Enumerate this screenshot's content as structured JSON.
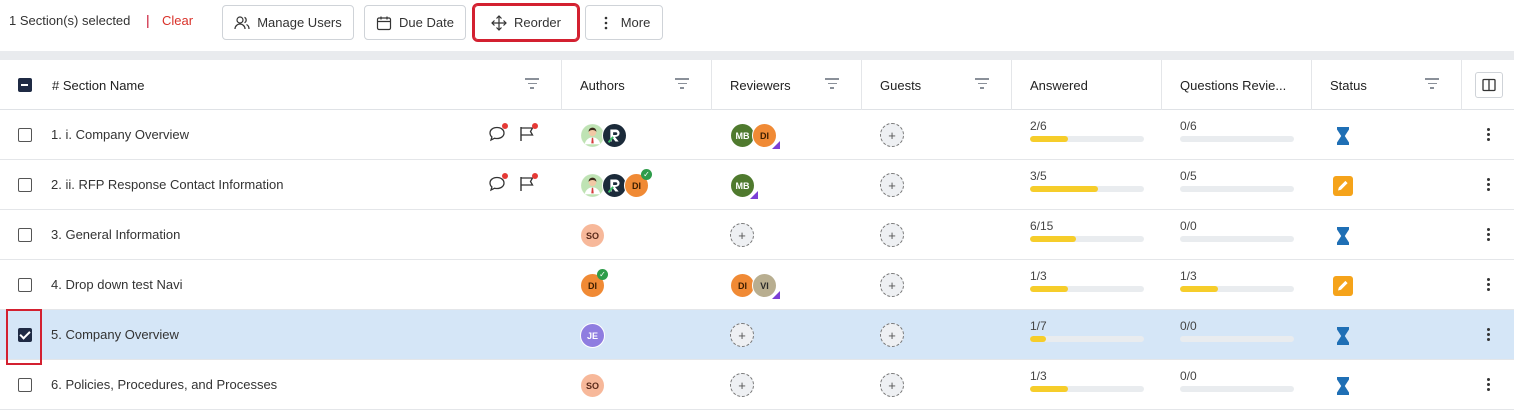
{
  "toolbar": {
    "selection_text": "1 Section(s) selected",
    "separator": "|",
    "clear_label": "Clear",
    "buttons": {
      "manage_users": "Manage Users",
      "due_date": "Due Date",
      "reorder": "Reorder",
      "more": "More"
    }
  },
  "table": {
    "headers": {
      "section_name": "# Section Name",
      "authors": "Authors",
      "reviewers": "Reviewers",
      "guests": "Guests",
      "answered": "Answered",
      "questions_reviewed": "Questions Revie...",
      "status": "Status"
    },
    "rows": [
      {
        "num": "1.",
        "name": "i. Company Overview",
        "answered": "2/6",
        "answered_frac": 0.333,
        "reviewed": "0/6",
        "reviewed_frac": 0,
        "status": "hourglass"
      },
      {
        "num": "2.",
        "name": "ii. RFP Response Contact Information",
        "answered": "3/5",
        "answered_frac": 0.6,
        "reviewed": "0/5",
        "reviewed_frac": 0,
        "status": "edit"
      },
      {
        "num": "3.",
        "name": "General Information",
        "answered": "6/15",
        "answered_frac": 0.4,
        "reviewed": "0/0",
        "reviewed_frac": 0,
        "status": "hourglass"
      },
      {
        "num": "4.",
        "name": "Drop down test Navi",
        "answered": "1/3",
        "answered_frac": 0.333,
        "reviewed": "1/3",
        "reviewed_frac": 0.333,
        "status": "edit"
      },
      {
        "num": "5.",
        "name": "Company Overview",
        "answered": "1/7",
        "answered_frac": 0.143,
        "reviewed": "0/0",
        "reviewed_frac": 0,
        "status": "hourglass"
      },
      {
        "num": "6.",
        "name": "Policies, Procedures, and Processes",
        "answered": "1/3",
        "answered_frac": 0.333,
        "reviewed": "0/0",
        "reviewed_frac": 0,
        "status": "hourglass"
      }
    ],
    "avatars": {
      "so": "SO",
      "di": "DI",
      "je": "JE",
      "mb": "MB",
      "vi": "VI"
    }
  },
  "colors": {
    "accent_red": "#d32030",
    "progress_fill": "#f6cd2a",
    "status_hourglass": "#1f6fb5",
    "status_edit": "#f5a31a",
    "selected_row": "#d5e6f7"
  }
}
